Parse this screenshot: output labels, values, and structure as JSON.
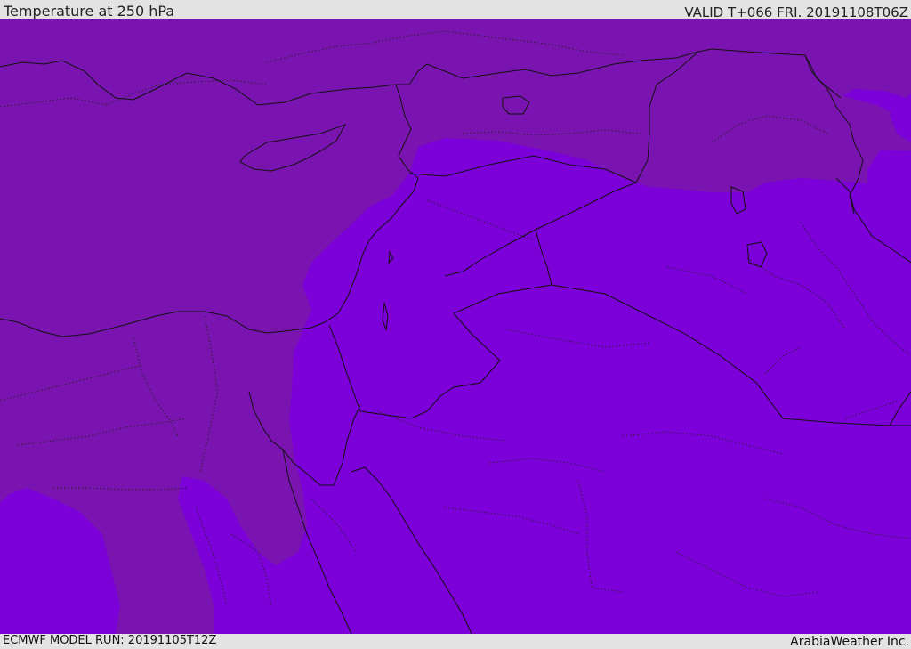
{
  "header": {
    "title": "Temperature at 250 hPa",
    "valid": "VALID T+066 FRI. 20191108T06Z"
  },
  "footer": {
    "model_run": "ECMWF MODEL RUN: 20191105T12Z",
    "credit": "ArabiaWeather Inc."
  },
  "colors": {
    "background_band": "#e3e3e3",
    "temperature_warm_band": "#7a14b0",
    "temperature_cold_band": "#7c00d8",
    "coastline": "#111111",
    "border": "#222222"
  }
}
